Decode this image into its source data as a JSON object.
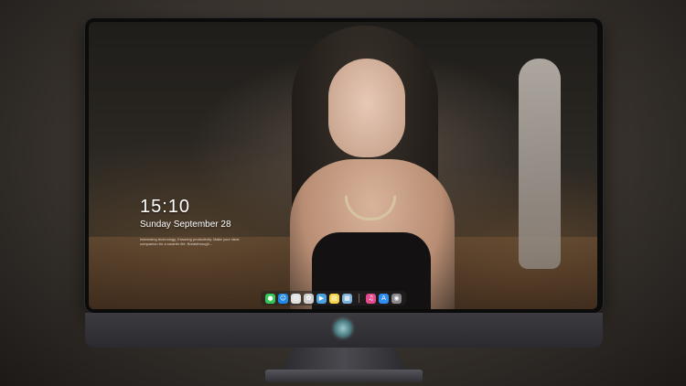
{
  "lockscreen": {
    "time": "15:10",
    "date": "Sunday September 28",
    "tagline": "Interesting technology, Ensuring productivity. Make your ideal companion for a smarter life. Breakthrough..."
  },
  "dock": {
    "apps": [
      {
        "name": "messages-icon",
        "glyph": "●",
        "color": "#35c759"
      },
      {
        "name": "finder-icon",
        "glyph": "☺",
        "color": "#1e88e5"
      },
      {
        "name": "clock-icon",
        "glyph": "◷",
        "color": "#e0e0e0"
      },
      {
        "name": "photos-icon",
        "glyph": "✿",
        "color": "#d0d0d0"
      },
      {
        "name": "clapper-icon",
        "glyph": "▶",
        "color": "#4aa3df"
      },
      {
        "name": "notes-icon",
        "glyph": "▤",
        "color": "#f5d547"
      },
      {
        "name": "preview-icon",
        "glyph": "▦",
        "color": "#7bb0d8"
      },
      {
        "name": "music-icon",
        "glyph": "♫",
        "color": "#e24c8f"
      },
      {
        "name": "app-store-icon",
        "glyph": "A",
        "color": "#2f8cf0"
      },
      {
        "name": "camera-icon",
        "glyph": "◉",
        "color": "#8a8a90"
      }
    ]
  }
}
